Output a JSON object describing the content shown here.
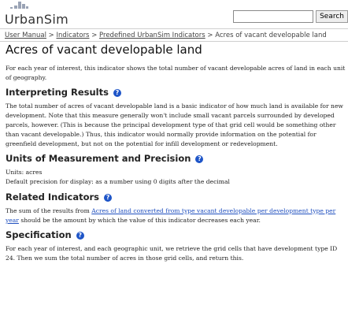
{
  "header": {
    "logo_text": "UrbanSim",
    "search": {
      "value": "",
      "placeholder": ""
    },
    "search_button": "Search"
  },
  "breadcrumb": {
    "items": [
      "User Manual",
      "Indicators",
      "Predefined UrbanSim Indicators"
    ],
    "separator": ">",
    "current": "Acres of vacant developable land"
  },
  "page": {
    "title": "Acres of vacant developable land",
    "intro": "For each year of interest, this indicator shows the total number of vacant developable acres of land in each unit of geography.",
    "sections": {
      "interpreting": {
        "heading": "Interpreting Results",
        "text": "The total number of acres of vacant developable land is a basic indicator of how much land is available for new development. Note that this measure generally won't include small vacant parcels surrounded by developed parcels, however. (This is because the principal development type of that grid cell would be something other than vacant developable.) Thus, this indicator would normally provide information on the potential for greenfield development, but not on the potential for infill development or redevelopment."
      },
      "units": {
        "heading": "Units of Measurement and Precision",
        "units_line": "Units: acres",
        "precision_line": "Default precision for display: as a number using 0 digits after the decimal"
      },
      "related": {
        "heading": "Related Indicators",
        "text_before": "The sum of the results from ",
        "link_text": "Acres of land converted from type vacant developable per development type per year",
        "text_after": " should be the amount by which the value of this indicator decreases each year."
      },
      "specification": {
        "heading": "Specification",
        "text": "For each year of interest, and each geographic unit, we retrieve the grid cells that have development type ID 24. Then we sum the total number of acres in those grid cells, and return this."
      }
    }
  },
  "colors": {
    "link": "#1f4fbf",
    "help_icon": "#1e55c8",
    "logo": "#9aa3b5"
  },
  "icons": {
    "help": "help-icon",
    "logo": "urbansim-logo"
  }
}
